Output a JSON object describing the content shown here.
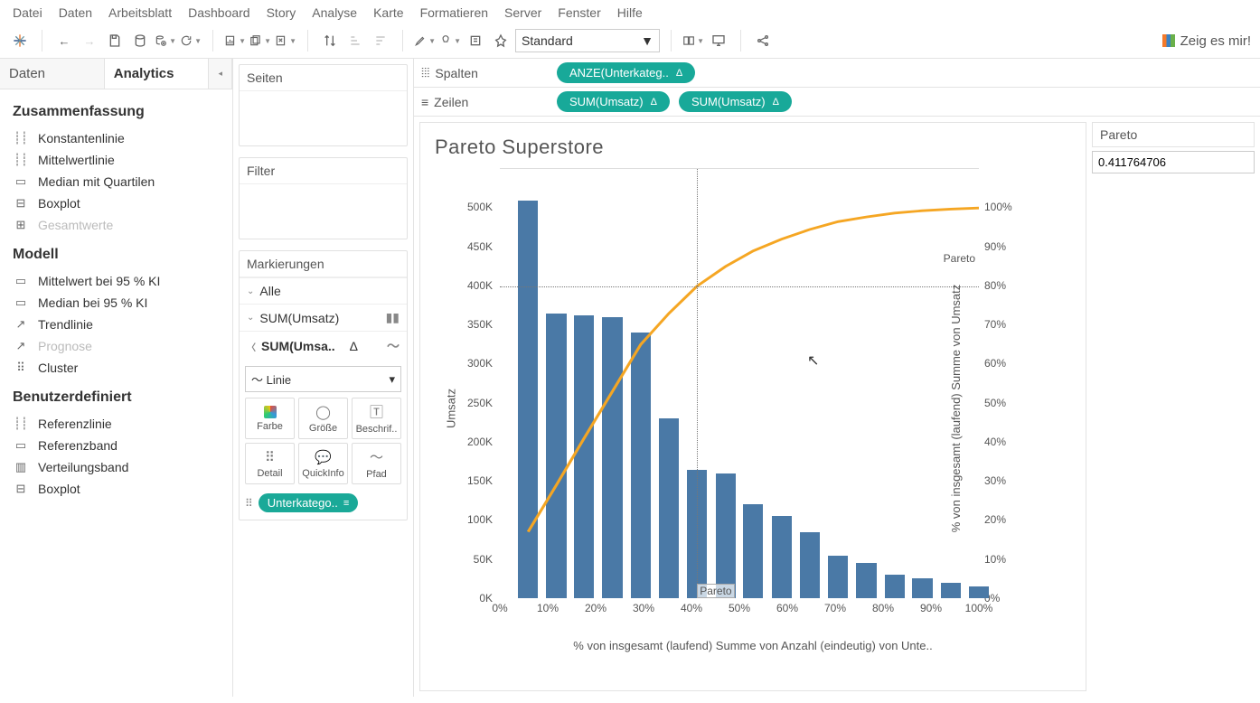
{
  "menu": [
    "Datei",
    "Daten",
    "Arbeitsblatt",
    "Dashboard",
    "Story",
    "Analyse",
    "Karte",
    "Formatieren",
    "Server",
    "Fenster",
    "Hilfe"
  ],
  "toolbar": {
    "view_mode": "Standard",
    "showme": "Zeig es mir!"
  },
  "side_tabs": {
    "data": "Daten",
    "analytics": "Analytics"
  },
  "analytics": {
    "summarize": {
      "title": "Zusammenfassung",
      "items": [
        {
          "icon": "┊┊",
          "label": "Konstantenlinie",
          "disabled": false
        },
        {
          "icon": "┊┊",
          "label": "Mittelwertlinie",
          "disabled": false
        },
        {
          "icon": "▭",
          "label": "Median mit Quartilen",
          "disabled": false
        },
        {
          "icon": "⊟",
          "label": "Boxplot",
          "disabled": false
        },
        {
          "icon": "⊞",
          "label": "Gesamtwerte",
          "disabled": true
        }
      ]
    },
    "model": {
      "title": "Modell",
      "items": [
        {
          "icon": "▭",
          "label": "Mittelwert bei 95 % KI",
          "disabled": false
        },
        {
          "icon": "▭",
          "label": "Median bei 95 % KI",
          "disabled": false
        },
        {
          "icon": "↗",
          "label": "Trendlinie",
          "disabled": false
        },
        {
          "icon": "↗",
          "label": "Prognose",
          "disabled": true
        },
        {
          "icon": "⠿",
          "label": "Cluster",
          "disabled": false
        }
      ]
    },
    "custom": {
      "title": "Benutzerdefiniert",
      "items": [
        {
          "icon": "┊┊",
          "label": "Referenzlinie",
          "disabled": false
        },
        {
          "icon": "▭",
          "label": "Referenzband",
          "disabled": false
        },
        {
          "icon": "▥",
          "label": "Verteilungsband",
          "disabled": false
        },
        {
          "icon": "⊟",
          "label": "Boxplot",
          "disabled": false
        }
      ]
    }
  },
  "midcol": {
    "pages": "Seiten",
    "filter": "Filter",
    "marks": "Markierungen",
    "mark_rows": {
      "all": "Alle",
      "s1": "SUM(Umsatz)",
      "s2": "SUM(Umsa..",
      "s2_delta": "Δ"
    },
    "mark_type": "Linie",
    "mark_btns": {
      "color": "Farbe",
      "size": "Größe",
      "label": "Beschrif..",
      "detail": "Detail",
      "tooltip": "QuickInfo",
      "path": "Pfad"
    },
    "field_pill": "Unterkatego.."
  },
  "shelves": {
    "columns_label": "Spalten",
    "rows_label": "Zeilen",
    "col_pill": "ANZE(Unterkateg..",
    "row_pill1": "SUM(Umsatz)",
    "row_pill2": "SUM(Umsatz)"
  },
  "viz": {
    "title": "Pareto Superstore",
    "y_left": "Umsatz",
    "y_right": "% von insgesamt (laufend) Summe von Umsatz",
    "x_label": "% von insgesamt (laufend) Summe von Anzahl (eindeutig) von Unte..",
    "ref_label": "Pareto"
  },
  "rightpanel": {
    "title": "Pareto",
    "value": "0.411764706"
  },
  "chart_data": {
    "type": "bar",
    "title": "Pareto Superstore",
    "xlabel": "% von insgesamt (laufend) Summe von Anzahl (eindeutig) von Unte..",
    "ylabel": "Umsatz",
    "y2label": "% von insgesamt (laufend) Summe von Umsatz",
    "x_ticks": [
      "0%",
      "10%",
      "20%",
      "30%",
      "40%",
      "50%",
      "60%",
      "70%",
      "80%",
      "90%",
      "100%"
    ],
    "y_left_ticks": [
      "0K",
      "50K",
      "100K",
      "150K",
      "200K",
      "250K",
      "300K",
      "350K",
      "400K",
      "450K",
      "500K"
    ],
    "y_right_ticks": [
      "0%",
      "10%",
      "20%",
      "30%",
      "40%",
      "50%",
      "60%",
      "70%",
      "80%",
      "90%",
      "100%"
    ],
    "ylim": [
      0,
      550000
    ],
    "y2lim": [
      0,
      1.0
    ],
    "pareto_ref_x": 0.4118,
    "pareto_ref_y": 0.8,
    "series": [
      {
        "name": "Umsatz (bars)",
        "type": "bar",
        "x_pct": [
          5.9,
          11.8,
          17.6,
          23.5,
          29.4,
          35.3,
          41.2,
          47.1,
          52.9,
          58.8,
          64.7,
          70.6,
          76.5,
          82.4,
          88.2,
          94.1,
          100.0
        ],
        "values": [
          510000,
          365000,
          362000,
          360000,
          340000,
          230000,
          165000,
          160000,
          120000,
          105000,
          85000,
          55000,
          45000,
          30000,
          25000,
          20000,
          15000
        ]
      },
      {
        "name": "% laufend Summe",
        "type": "line",
        "x_pct": [
          5.9,
          11.8,
          17.6,
          23.5,
          29.4,
          35.3,
          41.2,
          47.1,
          52.9,
          58.8,
          64.7,
          70.6,
          76.5,
          82.4,
          88.2,
          94.1,
          100.0
        ],
        "values": [
          0.17,
          0.29,
          0.41,
          0.53,
          0.65,
          0.73,
          0.8,
          0.85,
          0.89,
          0.92,
          0.945,
          0.965,
          0.977,
          0.987,
          0.993,
          0.997,
          1.0
        ]
      }
    ]
  }
}
